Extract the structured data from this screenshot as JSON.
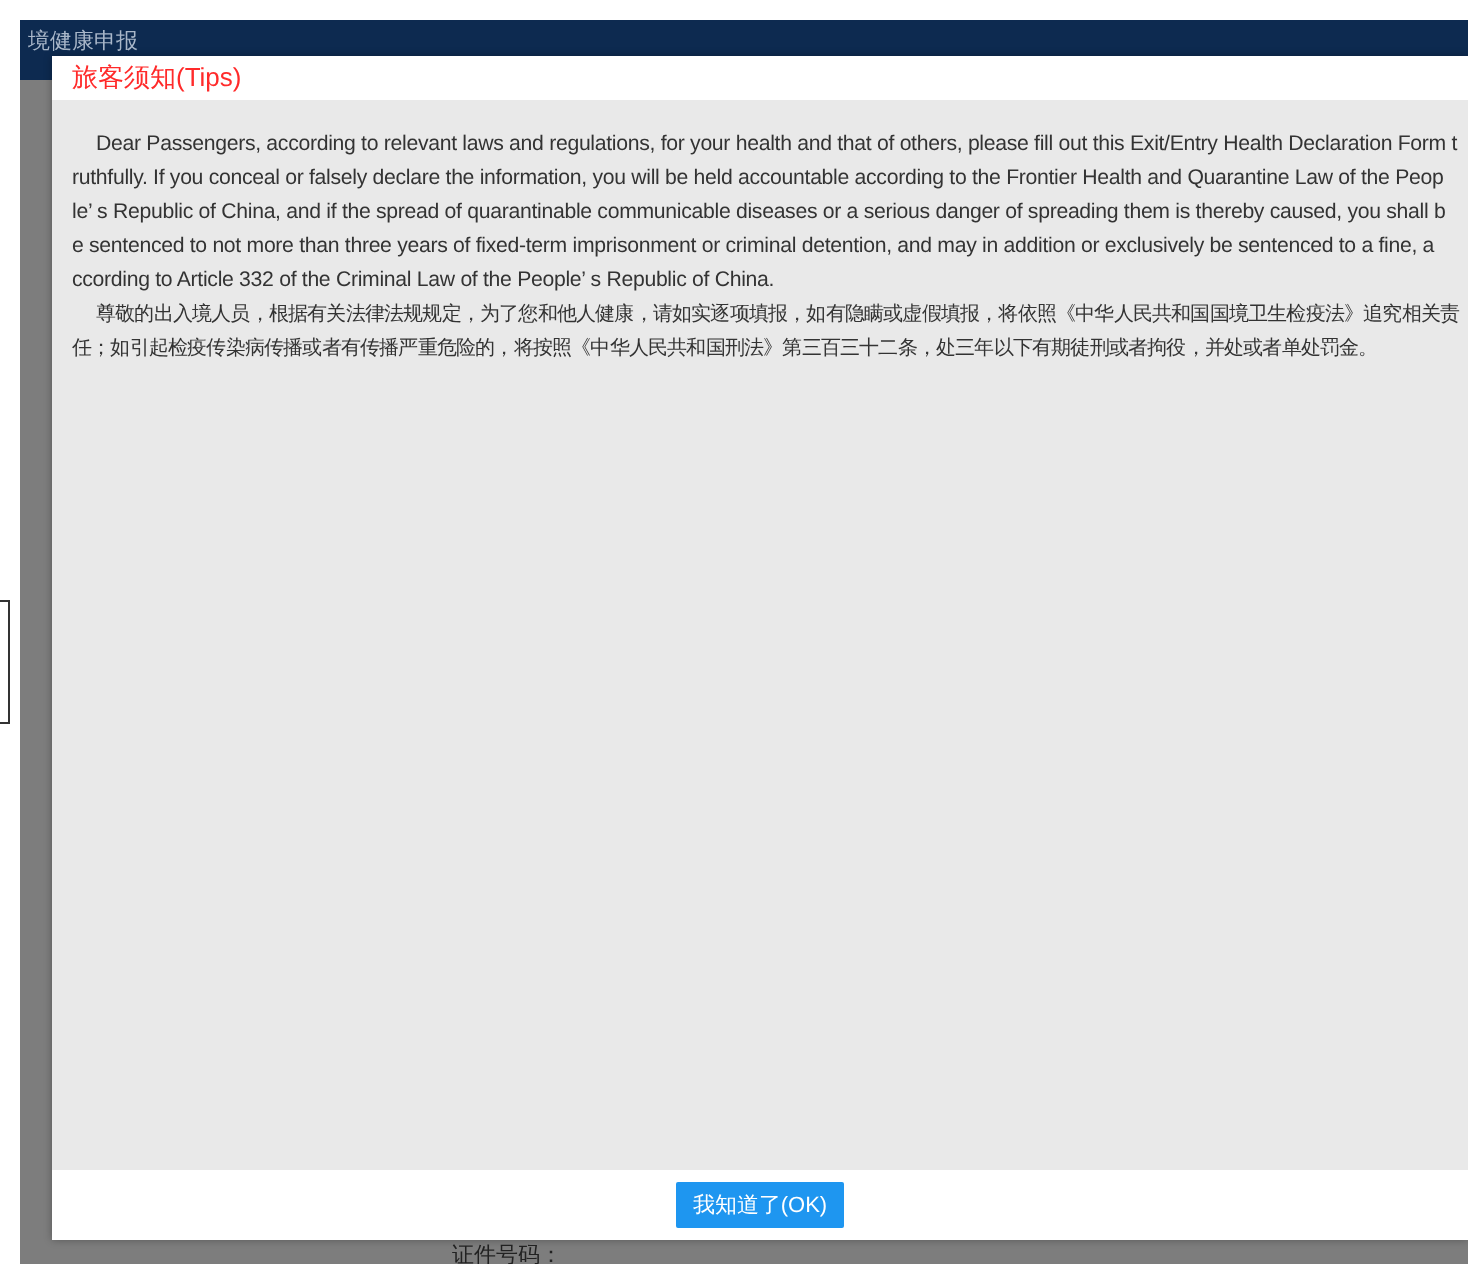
{
  "page": {
    "header_title": "境健康申报",
    "field_label": "证件号码："
  },
  "dialog": {
    "title": "旅客须知(Tips)",
    "paragraphs": [
      {
        "kind": "latin",
        "lines": [
          "Dear Passengers, according to relevant laws and regulations, for your health and that of others, please fill out this Exit/Entry Health Declaration Form t",
          "ruthfully. If you conceal or falsely declare the information, you will be held accountable according to the Frontier Health and Quarantine Law of the Peop",
          "le’ s Republic of China, and if the spread of quarantinable communicable diseases or a serious danger of spreading them is thereby caused, you shall b",
          "e sentenced to not more than three years of fixed-term imprisonment or criminal detention, and may in addition or exclusively be sentenced to a fine, a",
          "ccording to Article 332 of the Criminal Law of the People’ s Republic of China."
        ]
      },
      {
        "kind": "cjk",
        "lines": [
          "尊敬的出入境人员，根据有关法律法规规定，为了您和他人健康，请如实逐项填报，如有隐瞒或虚假填报，将依照《中华人民共和国国境卫生检疫法》追究相关责",
          "任；如引起检疫传染病传播或者有传播严重危险的，将按照《中华人民共和国刑法》第三百三十二条，处三年以下有期徒刑或者拘役，并处或者单处罚金。"
        ]
      }
    ],
    "ok_button": "我知道了(OK)"
  }
}
